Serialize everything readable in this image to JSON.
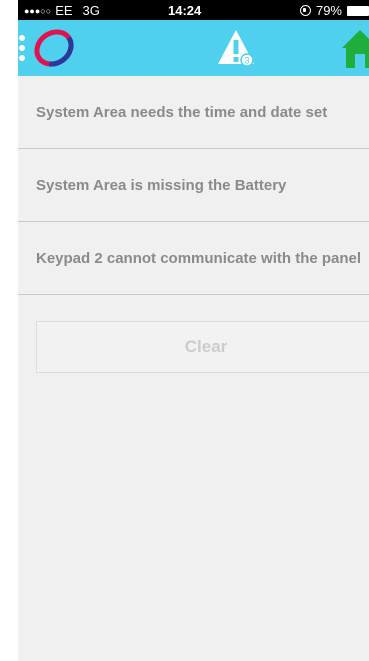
{
  "status_bar": {
    "signal": "●●●○○",
    "carrier": "EE",
    "network": "3G",
    "time": "14:24",
    "battery": "79%"
  },
  "header": {
    "alert_count": "3",
    "accent_color": "#4fd0ee",
    "home_color": "#1fae3b"
  },
  "alerts": [
    {
      "text": "System Area needs the time and date set"
    },
    {
      "text": "System Area is missing the Battery"
    },
    {
      "text": "Keypad 2 cannot communicate with the panel"
    }
  ],
  "actions": {
    "clear_label": "Clear"
  }
}
